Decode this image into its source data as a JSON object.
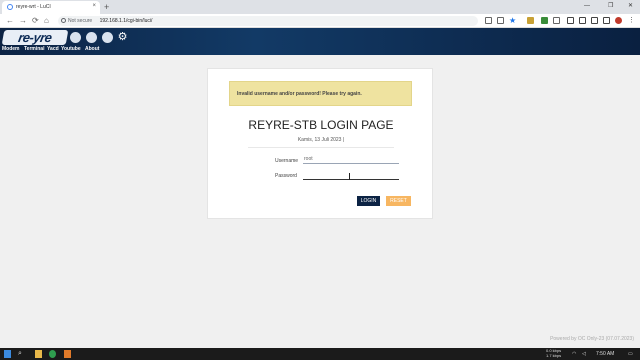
{
  "browser": {
    "tab_title": "reyre-wrt - LuCI",
    "tab_close": "×",
    "new_tab": "+",
    "security_label": "Not secure",
    "url": "192.168.1.1/cgi-bin/luci/",
    "win_min": "—",
    "win_max": "❐",
    "win_close": "✕",
    "back": "←",
    "forward": "→",
    "reload": "⟳",
    "home": "⌂"
  },
  "header": {
    "logo_text": "re-yre",
    "menu": [
      "Modem",
      "Terminal",
      "Yacd",
      "Youtube",
      "About"
    ]
  },
  "login": {
    "alert": "Invalid username and/or password! Please try again.",
    "title": "REYRE-STB LOGIN PAGE",
    "date": "Kamis, 13 Juli 2023 |",
    "username_label": "Username",
    "username_value": "root",
    "password_label": "Password",
    "password_value": "",
    "login_button": "LOGIN",
    "reset_button": "RESET"
  },
  "footer": {
    "powered": "Powered by OC Only-23 (07.07.2023)"
  },
  "taskbar": {
    "net_down": "0.0 kbps",
    "net_up": "1.7 kbps",
    "time": "7:50 AM"
  },
  "colors": {
    "header_bg": "#0c2344",
    "alert_bg": "#efe3a0",
    "login_btn": "#0c2344",
    "reset_btn": "#f7b661"
  }
}
